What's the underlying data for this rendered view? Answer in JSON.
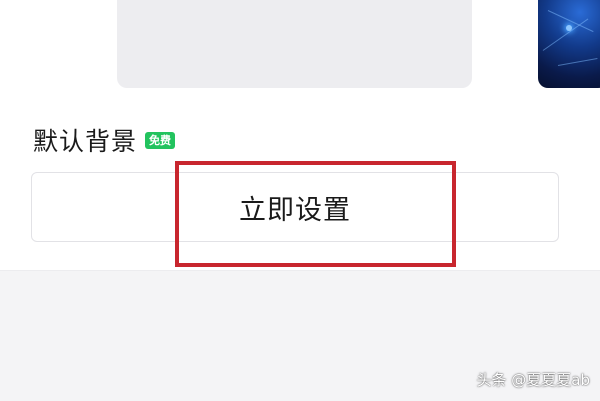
{
  "section": {
    "title": "默认背景",
    "badge": "免费"
  },
  "action_button": {
    "label": "立即设置"
  },
  "watermark": "头条 @夏夏夏ab",
  "colors": {
    "badge_bg": "#22c35e",
    "highlight_border": "#c8262e",
    "card_bg": "#ededf0",
    "bottom_bg": "#f4f4f6"
  }
}
